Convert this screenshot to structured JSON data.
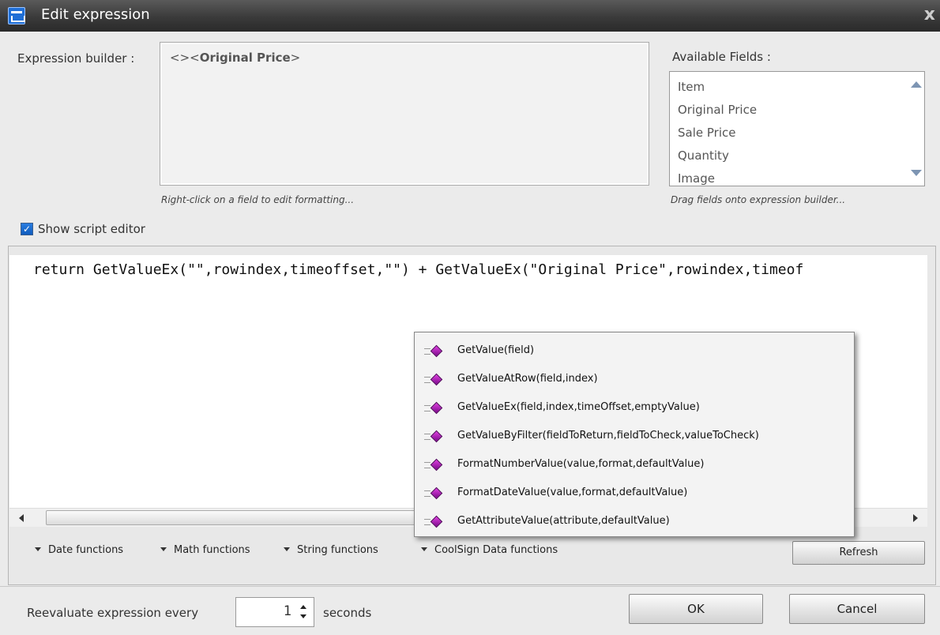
{
  "window": {
    "title": "Edit expression",
    "close_glyph": "x",
    "icon": "app-window-icon"
  },
  "expression_builder": {
    "label": "Expression builder :",
    "prefix": "<><",
    "field": "Original Price",
    "suffix": ">",
    "hint": "Right-click on a field to edit formatting..."
  },
  "available_fields": {
    "label": "Available Fields :",
    "items": [
      "Item",
      "Original Price",
      "Sale Price",
      "Quantity",
      "Image"
    ],
    "hint": "Drag fields onto expression builder..."
  },
  "script_editor": {
    "checkbox_label": "Show script editor",
    "checked": true,
    "code": "return GetValueEx(\"\",rowindex,timeoffset,\"\") + GetValueEx(\"Original Price\",rowindex,timeof"
  },
  "autocomplete": {
    "items": [
      "GetValue(field)",
      "GetValueAtRow(field,index)",
      "GetValueEx(field,index,timeOffset,emptyValue)",
      "GetValueByFilter(fieldToReturn,fieldToCheck,valueToCheck)",
      "FormatNumberValue(value,format,defaultValue)",
      "FormatDateValue(value,format,defaultValue)",
      "GetAttributeValue(attribute,defaultValue)"
    ],
    "icon": "method-icon"
  },
  "function_menus": [
    "Date functions",
    "Math functions",
    "String functions",
    "CoolSign Data functions"
  ],
  "refresh_label": "Refresh",
  "reevaluate": {
    "label": "Reevaluate expression every",
    "value": "1",
    "unit": "seconds"
  },
  "buttons": {
    "ok": "OK",
    "cancel": "Cancel"
  }
}
